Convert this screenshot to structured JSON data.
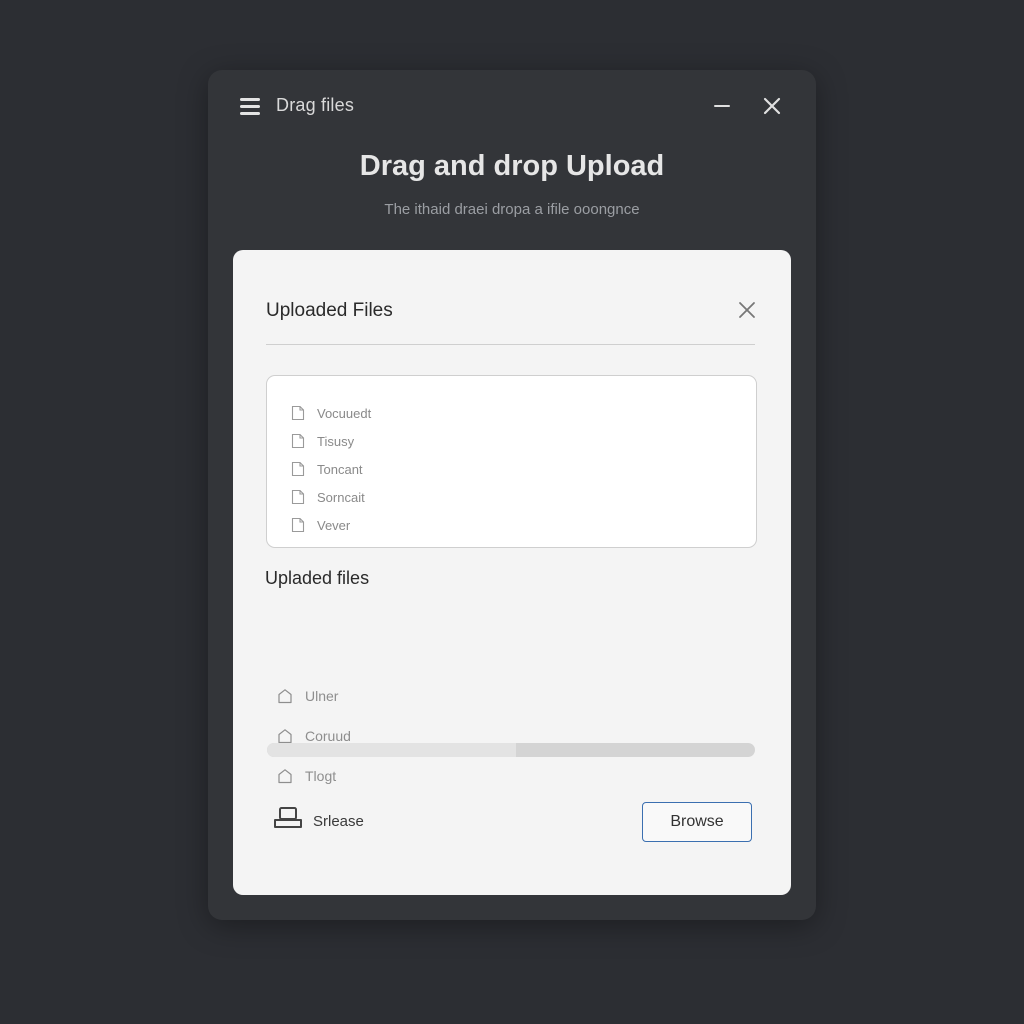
{
  "window": {
    "title": "Drag files"
  },
  "header": {
    "heading": "Drag and drop Upload",
    "subheading": "The ithaid draei dropa a ifile ooongnce"
  },
  "panel": {
    "title": "Uploaded Files",
    "dropzone_items": [
      {
        "label": "Vocuuedt",
        "icon": "file-icon"
      },
      {
        "label": "Tisusy",
        "icon": "file-icon"
      },
      {
        "label": "Toncant",
        "icon": "file-icon"
      },
      {
        "label": "Sorncait",
        "icon": "file-icon"
      },
      {
        "label": "Vever",
        "icon": "file-icon"
      }
    ],
    "uploaded_section_title": "Upladed files",
    "uploaded_items": [
      {
        "label": "Ulner",
        "icon": "home-icon"
      },
      {
        "label": "Coruud",
        "icon": "home-icon"
      },
      {
        "label": "Tlogt",
        "icon": "home-icon"
      }
    ],
    "progress": 0.51,
    "release_label": "Srlease",
    "browse_label": "Browse"
  },
  "colors": {
    "background": "#2c2e33",
    "window": "#333539",
    "panel": "#f4f4f4",
    "browse_border": "#3b6fb0"
  }
}
